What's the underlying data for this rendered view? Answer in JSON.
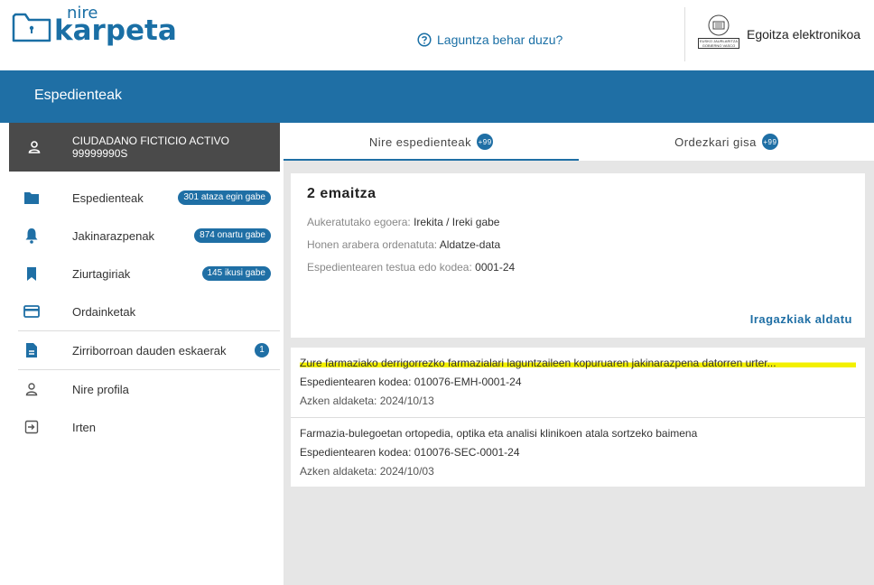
{
  "header": {
    "logo_small": "nire",
    "logo_big": "karpeta",
    "help_label": "Laguntza behar duzu?",
    "egoitza_label": "Egoitza elektronikoa",
    "gv_logo_text": "EUSKO JAURLARITZA GOBIERNO VASCO"
  },
  "band": {
    "title": "Espedienteak"
  },
  "user": {
    "name": "CIUDADANO FICTICIO ACTIVO",
    "id": "99999990S"
  },
  "sidebar": {
    "items": [
      {
        "label": "Espedienteak",
        "badge": "301 ataza egin gabe",
        "icon": "folder-icon"
      },
      {
        "label": "Jakinarazpenak",
        "badge": "874 onartu gabe",
        "icon": "bell-icon"
      },
      {
        "label": "Ziurtagiriak",
        "badge": "145 ikusi gabe",
        "icon": "bookmark-icon"
      },
      {
        "label": "Ordainketak",
        "badge": "",
        "icon": "credit-card-icon"
      },
      {
        "label": "Zirriborroan dauden eskaerak",
        "badge": "1",
        "icon": "document-icon"
      },
      {
        "label": "Nire profila",
        "badge": "",
        "icon": "user-icon"
      },
      {
        "label": "Irten",
        "badge": "",
        "icon": "logout-icon"
      }
    ]
  },
  "tabs": [
    {
      "label": "Nire espedienteak",
      "count": "+99"
    },
    {
      "label": "Ordezkari gisa",
      "count": "+99"
    }
  ],
  "results": {
    "count_label": "2 emaitza",
    "status_key": "Aukeratutako egoera:",
    "status_value": "Irekita / Ireki gabe",
    "order_key": "Honen arabera ordenatuta:",
    "order_value": "Aldatze-data",
    "text_key": "Espedientearen testua edo kodea:",
    "text_value": "0001-24",
    "filters_link": "Iragazkiak aldatu"
  },
  "files": [
    {
      "title": "Zure farmaziako derrigorrezko farmazialari laguntzaileen kopuruaren jakinarazpena datorren urter...",
      "code": "Espedientearen kodea: 010076-EMH-0001-24",
      "date": "Azken aldaketa: 2024/10/13"
    },
    {
      "title": "Farmazia-bulegoetan ortopedia, optika eta analisi klinikoen atala sortzeko baimena",
      "code": "Espedientearen kodea: 010076-SEC-0001-24",
      "date": "Azken aldaketa: 2024/10/03"
    }
  ],
  "colors": {
    "brand": "#1f6fa5",
    "user_bar": "#4a4a4a",
    "highlight": "#f3f000"
  }
}
